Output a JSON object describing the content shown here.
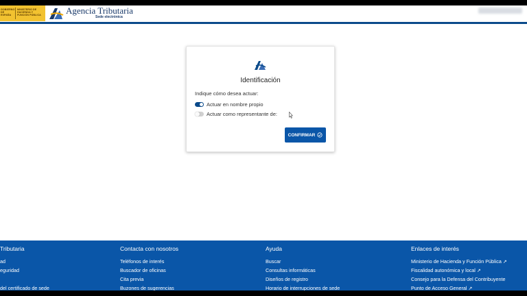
{
  "header": {
    "gov_left": "GOBIERNO DE ESPAÑA",
    "gov_right": "MINISTERIO DE HACIENDA Y FUNCIÓN PÚBLICA",
    "brand_name": "Agencia Tributaria",
    "brand_sub": "Sede electrónica"
  },
  "card": {
    "title": "Identificación",
    "prompt": "Indique cómo desea actuar:",
    "options": [
      {
        "label": "Actuar en nombre propio",
        "selected": true
      },
      {
        "label": "Actuar como representante de:",
        "selected": false
      }
    ],
    "confirm_label": "CONFIRMAR"
  },
  "footer": {
    "columns": [
      {
        "heading": "Tributaria",
        "items": [
          "ad",
          "eguridad",
          "",
          "del certificado de sede"
        ]
      },
      {
        "heading": "Contacta con nosotros",
        "items": [
          "Teléfonos de interés",
          "Buscador de oficinas",
          "Cita previa",
          "Buzones de sugerencias"
        ]
      },
      {
        "heading": "Ayuda",
        "items": [
          "Buscar",
          "Consultas informáticas",
          "Diseños de registro",
          "Horario de interrupciones de sede"
        ]
      },
      {
        "heading": "Enlaces de interés",
        "items": [
          "Ministerio de Hacienda y Función Pública",
          "Fiscalidad autonómica y local",
          "Consejo para la Defensa del Contribuyente",
          "Punto de Acceso General"
        ]
      }
    ]
  },
  "colors": {
    "brand_blue": "#0a56a8",
    "header_rule": "#0a4a8a",
    "gov_yellow": "#f2c230"
  },
  "icons": [
    "aeat-logo-icon",
    "check-circle-icon",
    "external-link-icon",
    "mouse-cursor-icon"
  ]
}
